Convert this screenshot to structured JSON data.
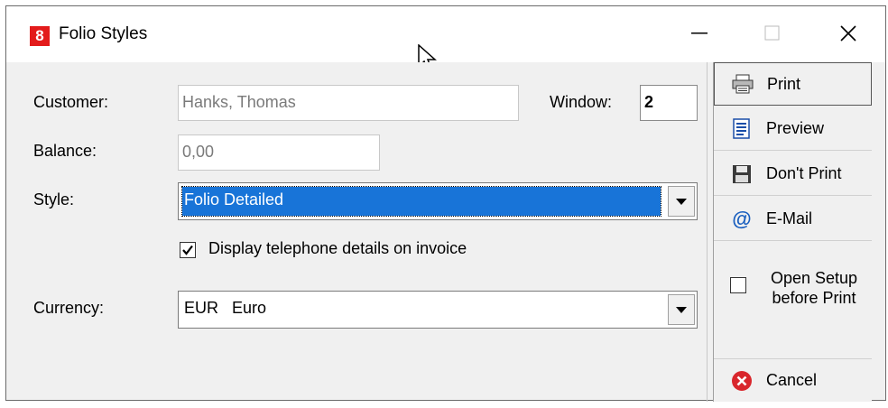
{
  "window": {
    "icon_text": "8",
    "title": "Folio Styles",
    "minimize_glyph": "—",
    "close_glyph": "✕"
  },
  "form": {
    "customer_label": "Customer:",
    "customer_value": "Hanks, Thomas",
    "window_label": "Window:",
    "window_value": "2",
    "balance_label": "Balance:",
    "balance_value": "0,00",
    "style_label": "Style:",
    "style_value": "Folio Detailed",
    "telephone_checkbox_label": "Display telephone details on invoice",
    "telephone_checked": true,
    "currency_label": "Currency:",
    "currency_value": "EUR   Euro"
  },
  "actions": {
    "print": "Print",
    "preview": "Preview",
    "dont_print": "Don't Print",
    "email": "E-Mail",
    "open_setup_line1": "Open Setup",
    "open_setup_line2": "before Print",
    "open_setup_checked": false,
    "cancel": "Cancel"
  },
  "icons": {
    "print": "printer-icon",
    "preview": "document-preview-icon",
    "dont_print": "floppy-disk-icon",
    "email": "at-sign-icon",
    "cancel": "cancel-icon"
  },
  "colors": {
    "app_icon_bg": "#e31b1b",
    "selection": "#1874d8",
    "cancel_red": "#d9262c"
  }
}
